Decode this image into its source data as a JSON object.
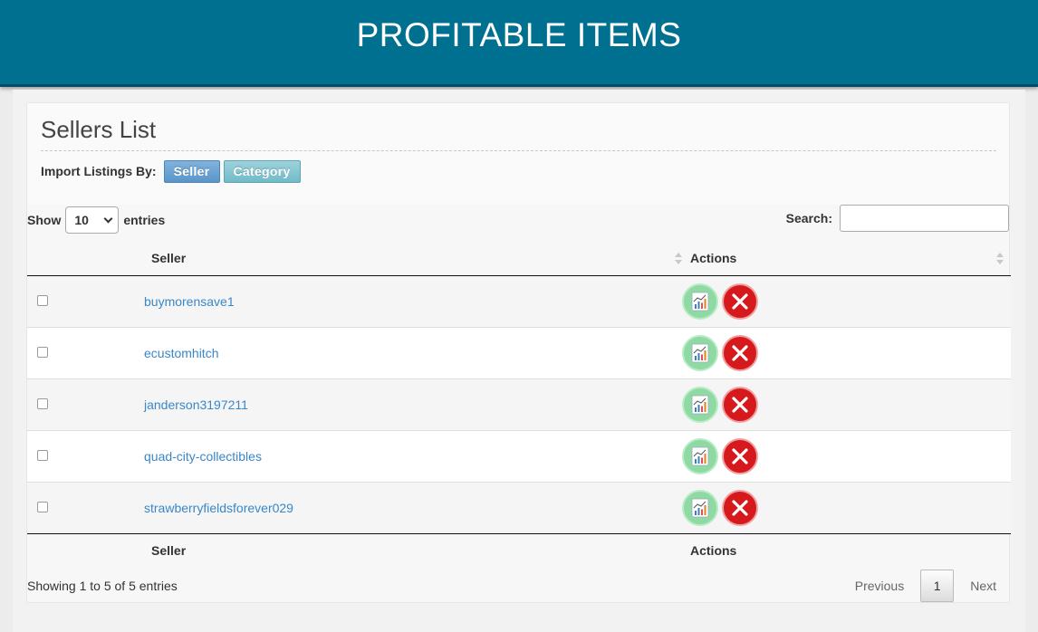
{
  "header": {
    "title": "PROFITABLE ITEMS"
  },
  "panel": {
    "title": "Sellers List",
    "import_label": "Import Listings By:",
    "import_buttons": {
      "seller": "Seller",
      "category": "Category"
    }
  },
  "controls": {
    "show_label": "Show",
    "page_size": "10",
    "entries_label": "entries",
    "search_label": "Search:",
    "search_value": ""
  },
  "table": {
    "columns": {
      "seller": "Seller",
      "actions": "Actions"
    },
    "rows": [
      {
        "seller": "buymorensave1"
      },
      {
        "seller": "ecustomhitch"
      },
      {
        "seller": "janderson3197211"
      },
      {
        "seller": "quad-city-collectibles"
      },
      {
        "seller": "strawberryfieldsforever029"
      }
    ]
  },
  "footer": {
    "info": "Showing 1 to 5 of 5 entries",
    "previous": "Previous",
    "current_page": "1",
    "next": "Next"
  },
  "icons": {
    "stats": "chart-stats-icon",
    "delete": "delete-x-icon"
  },
  "colors": {
    "header_bg": "#007091",
    "link": "#3a87c8",
    "delete": "#d6191c",
    "stats": "#8fd9a3"
  }
}
